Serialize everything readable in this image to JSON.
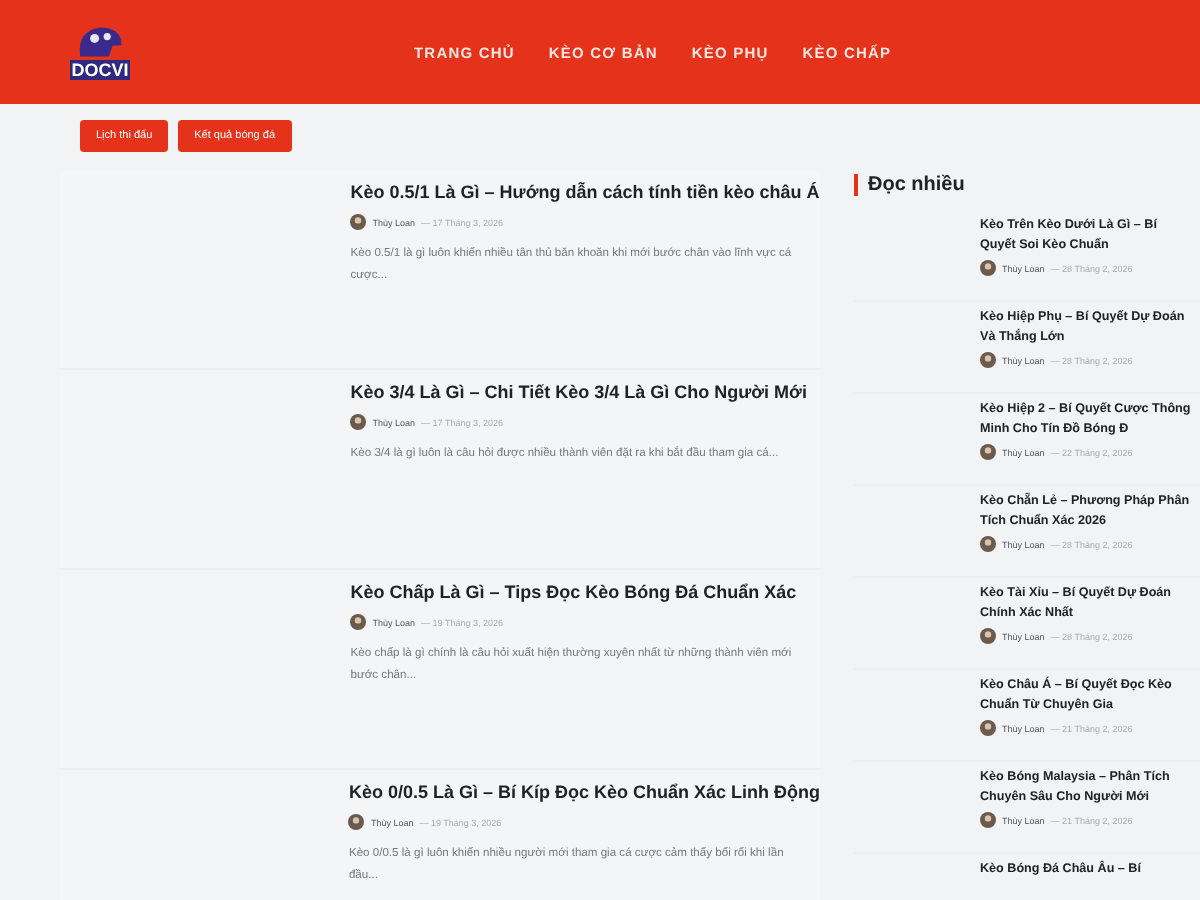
{
  "header": {
    "logo": "DOCVI",
    "nav": [
      {
        "label": "TRANG CHỦ"
      },
      {
        "label": "KÈO CƠ BẢN"
      },
      {
        "label": "KÈO PHỤ"
      },
      {
        "label": "KÈO CHẤP"
      }
    ]
  },
  "quick_buttons": [
    "Lịch thi đấu",
    "Kết quả bóng đá"
  ],
  "posts": [
    {
      "title": "Kèo 0.5/1 Là Gì – Hướng dẫn cách tính tiền kèo châu Á",
      "author": "Thùy Loan",
      "date": "— 17 Tháng 3, 2026",
      "excerpt": "Kèo 0.5/1 là gì luôn khiến nhiều tân thủ băn khoăn khi mới bước chân vào lĩnh vực cá cược..."
    },
    {
      "title": "Kèo 3/4 Là Gì – Chi Tiết Kèo 3/4 Là Gì Cho Người Mới",
      "author": "Thùy Loan",
      "date": "— 17 Tháng 3, 2026",
      "excerpt": "Kèo 3/4 là gì luôn là câu hỏi được nhiều thành viên đặt ra khi bắt đầu tham gia cá..."
    },
    {
      "title": "Kèo Chấp Là Gì – Tips Đọc Kèo Bóng Đá Chuẩn Xác",
      "author": "Thùy Loan",
      "date": "— 19 Tháng 3, 2026",
      "excerpt": "Kèo chấp là gì chính là câu hỏi xuất hiện thường xuyên nhất từ những thành viên mới bước chân..."
    },
    {
      "title": "Kèo 0/0.5 Là Gì – Bí Kíp Đọc Kèo Chuẩn Xác Linh Động",
      "author": "Thùy Loan",
      "date": "— 19 Tháng 3, 2026",
      "excerpt": "Kèo 0/0.5 là gì luôn khiến nhiều người mới tham gia cá cược cảm thấy bối rối khi lần đầu..."
    }
  ],
  "sidebar": {
    "heading": "Đọc nhiều",
    "items": [
      {
        "title": "Kèo Trên Kèo Dưới Là Gì – Bí Quyết Soi Kèo Chuẩn",
        "author": "Thùy Loan",
        "date": "— 28 Tháng 2, 2026"
      },
      {
        "title": "Kèo Hiệp Phụ – Bí Quyết Dự Đoán Và Thắng Lớn",
        "author": "Thùy Loan",
        "date": "— 28 Tháng 2, 2026"
      },
      {
        "title": "Kèo Hiệp 2 – Bí Quyết Cược Thông Minh Cho Tín Đồ Bóng Đ",
        "author": "Thùy Loan",
        "date": "— 22 Tháng 2, 2026"
      },
      {
        "title": "Kèo Chẵn Lẻ – Phương Pháp Phân Tích Chuẩn Xác 2026",
        "author": "Thùy Loan",
        "date": "— 28 Tháng 2, 2026"
      },
      {
        "title": "Kèo Tài Xỉu – Bí Quyết Dự Đoán Chính Xác Nhất",
        "author": "Thùy Loan",
        "date": "— 28 Tháng 2, 2026"
      },
      {
        "title": "Kèo Châu Á – Bí Quyết Đọc Kèo Chuẩn Từ Chuyên Gia",
        "author": "Thùy Loan",
        "date": "— 21 Tháng 2, 2026"
      },
      {
        "title": "Kèo Bóng Malaysia – Phân Tích Chuyên Sâu Cho Người Mới",
        "author": "Thùy Loan",
        "date": "— 21 Tháng 2, 2026"
      },
      {
        "title": "Kèo Bóng Đá Châu Âu – Bí"
      }
    ]
  }
}
